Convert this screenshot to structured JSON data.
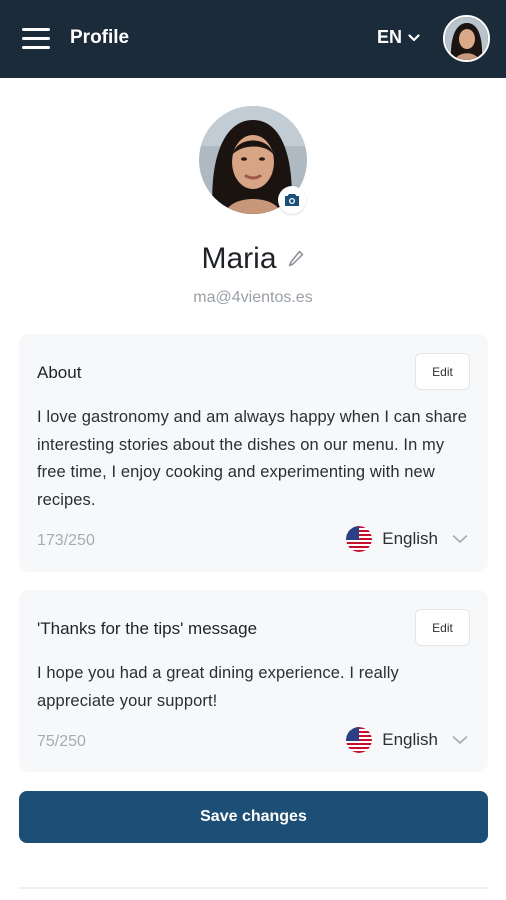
{
  "header": {
    "title": "Profile",
    "language": "EN",
    "background": "#1c2b3a"
  },
  "profile": {
    "name": "Maria",
    "email": "ma@4vientos.es"
  },
  "about": {
    "title": "About",
    "edit_label": "Edit",
    "text": "I love gastronomy and am always happy when I can share interesting stories about the dishes on our menu. In my free time, I enjoy cooking and experimenting with new recipes.",
    "counter": "173/250",
    "language": "English"
  },
  "tips_message": {
    "title": "'Thanks for the tips' message",
    "edit_label": "Edit",
    "text": "I hope you had a great dining experience. I really appreciate your support!",
    "counter": "75/250",
    "language": "English"
  },
  "actions": {
    "save_label": "Save changes",
    "accent": "#1d4e75"
  }
}
